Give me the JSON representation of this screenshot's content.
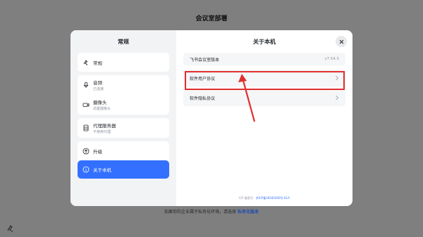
{
  "background": {
    "title": "会议室部署",
    "footer_text": "如果你的企业属于私有化环境，请选择",
    "footer_link": "私有化版本"
  },
  "sidebar": {
    "title": "常规",
    "items": [
      {
        "label": "常规",
        "icon": "settings-icon"
      },
      {
        "label": "音频",
        "sub": "已连接",
        "icon": "microphone-icon"
      },
      {
        "label": "摄像头",
        "sub": "前置摄像头",
        "icon": "camera-icon"
      },
      {
        "label": "代理服务器",
        "sub": "不使用代理",
        "icon": "server-icon"
      },
      {
        "label": "升级",
        "icon": "upgrade-icon"
      },
      {
        "label": "关于本机",
        "icon": "info-icon"
      }
    ]
  },
  "main": {
    "title": "关于本机",
    "version_label": "飞书会议室版本",
    "version_value": "v7.54.5",
    "user_agreement": "软件用户协议",
    "privacy_agreement": "软件隐私协议",
    "icp_label": "ICP 备案号：",
    "icp_code": "京ICP备16045400号-61A"
  },
  "colors": {
    "accent": "#3370ff",
    "highlight": "#e02e2e"
  }
}
